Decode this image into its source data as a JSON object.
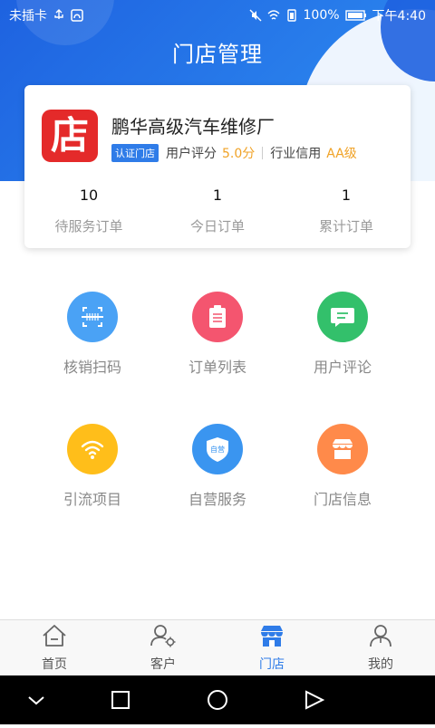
{
  "status_bar": {
    "carrier": "未插卡",
    "battery": "100%",
    "time": "下午4:40"
  },
  "header": {
    "title": "门店管理"
  },
  "store": {
    "logo_char": "店",
    "name": "鹏华高级汽车维修厂",
    "badge": "认证门店",
    "rating_label": "用户评分",
    "rating_value": "5.0分",
    "credit_label": "行业信用",
    "credit_value": "AA级",
    "stats": [
      {
        "value": "10",
        "label": "待服务订单"
      },
      {
        "value": "1",
        "label": "今日订单"
      },
      {
        "value": "1",
        "label": "累计订单"
      }
    ]
  },
  "features": [
    {
      "label": "核销扫码",
      "icon": "scan-icon",
      "color": "#4aa2f5"
    },
    {
      "label": "订单列表",
      "icon": "clipboard-icon",
      "color": "#f4556f"
    },
    {
      "label": "用户评论",
      "icon": "comment-icon",
      "color": "#33c06b"
    },
    {
      "label": "引流项目",
      "icon": "wifi-icon",
      "color": "#ffbe1a"
    },
    {
      "label": "自营服务",
      "icon": "shield-icon",
      "icon_text": "自营",
      "color": "#3a95f0"
    },
    {
      "label": "门店信息",
      "icon": "store-icon",
      "color": "#ff8a4a"
    }
  ],
  "bottom_nav": [
    {
      "label": "首页",
      "icon": "home-icon"
    },
    {
      "label": "客户",
      "icon": "customer-icon"
    },
    {
      "label": "门店",
      "icon": "store-icon",
      "active": true
    },
    {
      "label": "我的",
      "icon": "profile-icon"
    }
  ],
  "system_nav": [
    "back-chevron-icon",
    "recent-square-icon",
    "home-circle-icon",
    "back-triangle-icon"
  ]
}
